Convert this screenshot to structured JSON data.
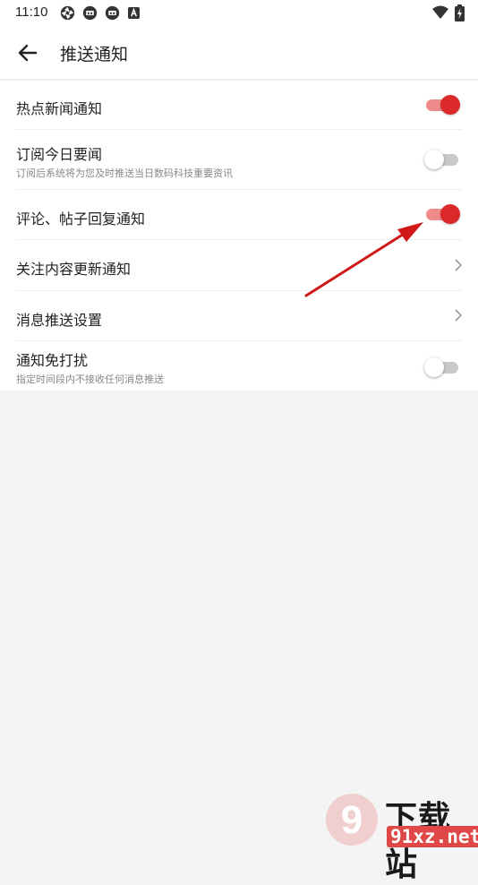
{
  "status_bar": {
    "time": "11:10",
    "notification_icons": [
      "aperture-icon",
      "news-app-icon",
      "news-app-icon",
      "accessibility-icon"
    ],
    "right_icons": [
      "wifi-icon",
      "battery-charging-icon"
    ]
  },
  "app_bar": {
    "title": "推送通知"
  },
  "settings": [
    {
      "label": "热点新闻通知",
      "sub": "",
      "control": "toggle",
      "on": true
    },
    {
      "label": "订阅今日要闻",
      "sub": "订阅后系统将为您及时推送当日数码科技重要资讯",
      "control": "toggle",
      "on": false
    },
    {
      "label": "评论、帖子回复通知",
      "sub": "",
      "control": "toggle",
      "on": true
    },
    {
      "label": "关注内容更新通知",
      "sub": "",
      "control": "chevron"
    },
    {
      "label": "消息推送设置",
      "sub": "",
      "control": "chevron"
    },
    {
      "label": "通知免打扰",
      "sub": "指定时间段内不接收任何消息推送",
      "control": "toggle",
      "on": false
    }
  ],
  "watermark": {
    "logo_text": "9",
    "brand": "下载站",
    "url": "91xz.net"
  },
  "colors": {
    "accent": "#db2828",
    "track_on": "#ef8a8a",
    "track_off": "#c9c9c9",
    "background": "#f4f4f4",
    "annotation_arrow": "#d01818"
  }
}
